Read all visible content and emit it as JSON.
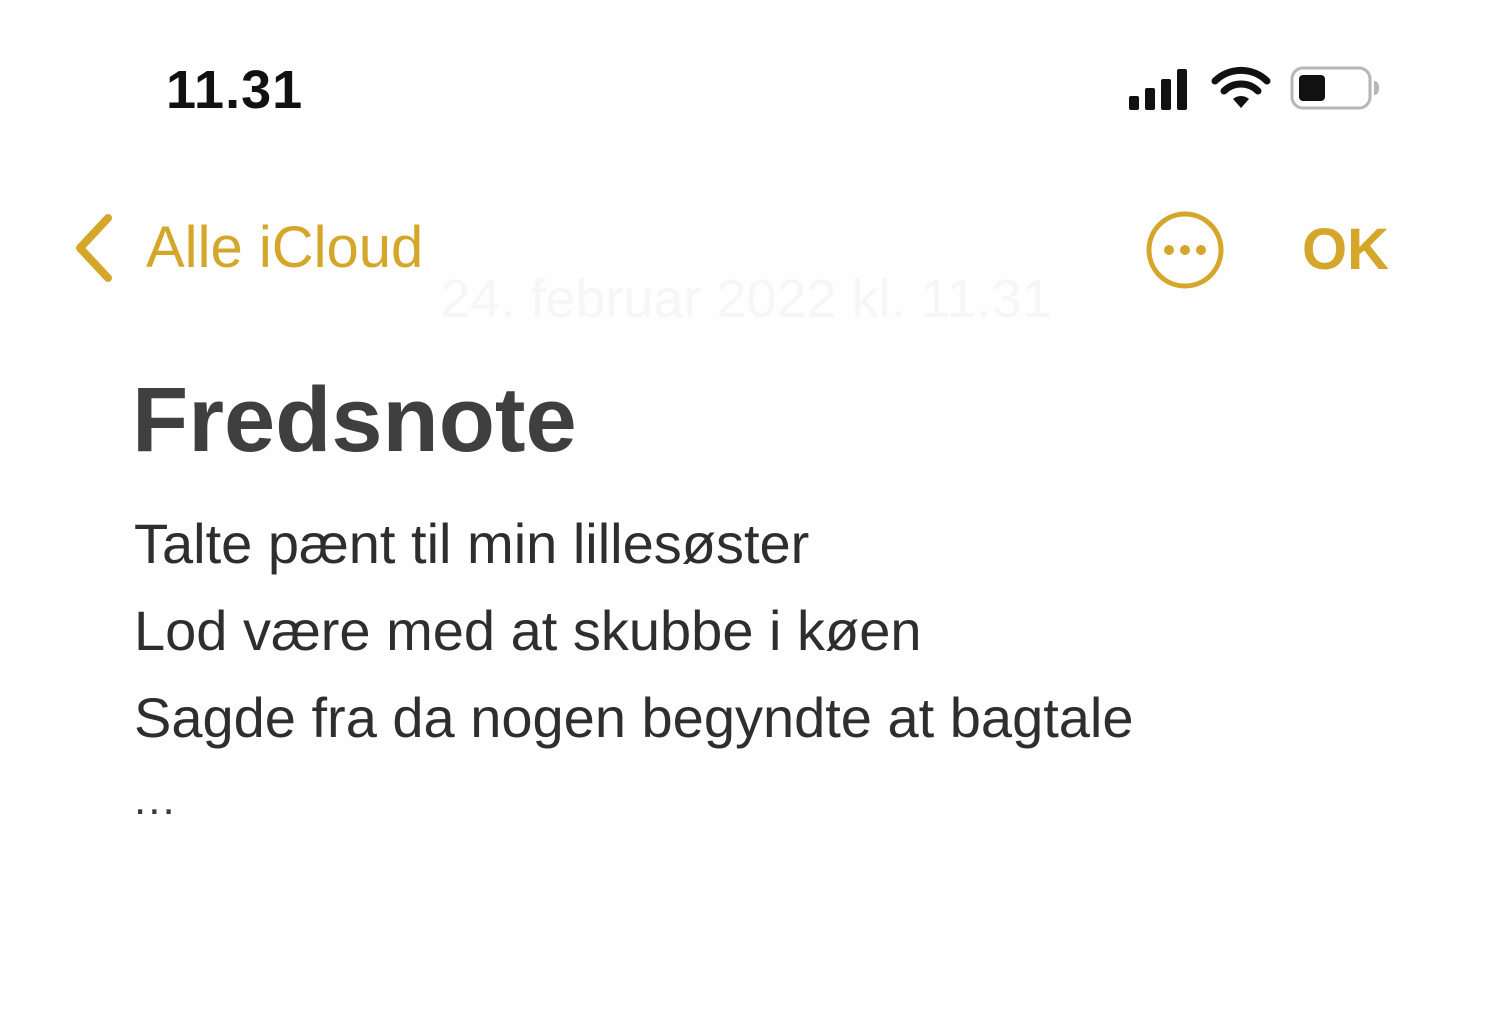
{
  "status_bar": {
    "time": "11.31",
    "icons": [
      "cellular-signal-icon",
      "wifi-icon",
      "battery-icon"
    ],
    "battery_level_percent": 40
  },
  "nav": {
    "back_label": "Alle iCloud",
    "back_icon": "chevron-left-icon",
    "more_icon": "ellipsis-circle-icon",
    "done_label": "OK",
    "date": "24. februar 2022 kl. 11.31"
  },
  "note": {
    "title": "Fredsnote",
    "lines": [
      "Talte pænt til min lillesøster",
      "Lod være med at skubbe i køen",
      "Sagde fra da nogen begyndte at bagtale"
    ],
    "trailing": "..."
  },
  "colors": {
    "accent": "#d4a62a",
    "title": "#3f3f3f",
    "text": "#2e2e2e",
    "background": "#fefefe"
  }
}
